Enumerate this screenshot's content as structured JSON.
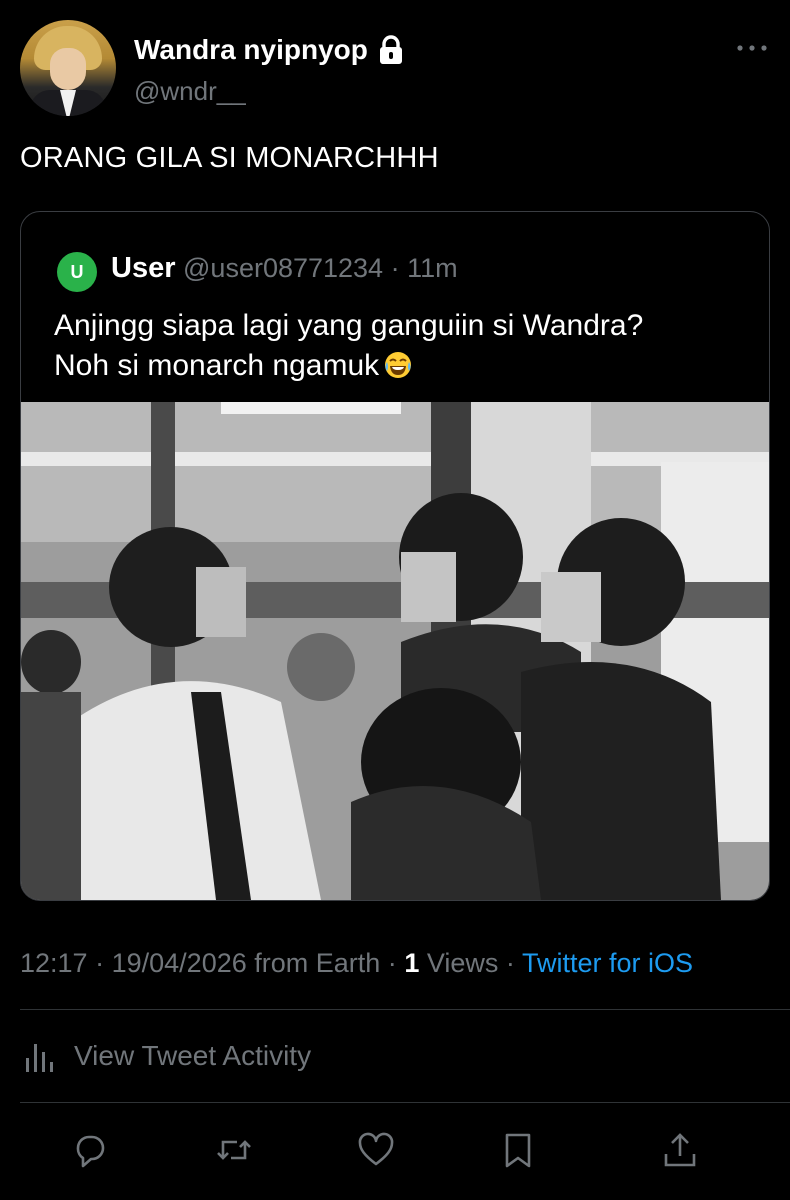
{
  "author": {
    "display_name": "Wandra nyipnyop",
    "handle": "@wndr__",
    "protected_icon": "lock-icon",
    "avatar_icon": "profile-photo"
  },
  "tweet": {
    "text": "ORANG GILA SI MONARCHHH"
  },
  "quoted_tweet": {
    "avatar_letter": "U",
    "avatar_color": "#2ab24a",
    "name": "User",
    "handle": "@user08771234",
    "separator": "·",
    "time": "11m",
    "text_line1": "Anjingg siapa lagi yang ganguiin si Wandra?",
    "text_line2": "Noh si monarch ngamuk",
    "emoji_icon": "face-with-tears-of-joy-icon"
  },
  "meta": {
    "time": "12:17",
    "sep1": "·",
    "date_location": "19/04/2026 from Earth",
    "sep2": "·",
    "views_count": "1",
    "views_label": "Views",
    "sep3": "·",
    "source": "Twitter for iOS",
    "source_color": "#1d9bf0"
  },
  "activity": {
    "label": "View Tweet Activity",
    "icon": "chart-bars-icon"
  },
  "actions": {
    "reply_icon": "reply-icon",
    "retweet_icon": "retweet-icon",
    "like_icon": "heart-icon",
    "bookmark_icon": "bookmark-icon",
    "share_icon": "share-icon"
  },
  "colors": {
    "background": "#000000",
    "primary_text": "#ffffff",
    "secondary_text": "#71767b",
    "divider": "#2f3336",
    "accent": "#1d9bf0"
  }
}
